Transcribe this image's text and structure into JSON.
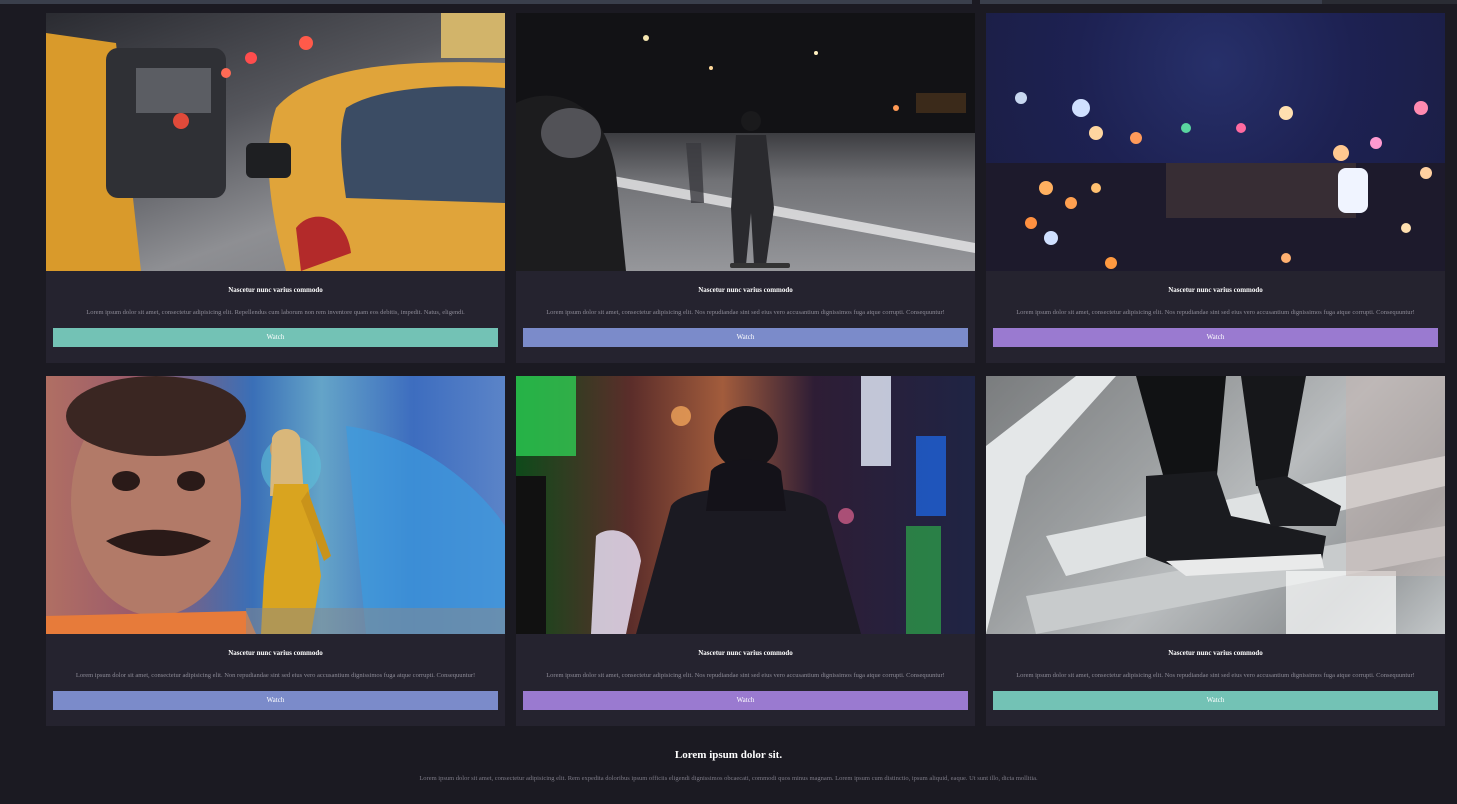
{
  "cards": [
    {
      "title": "Nascetur nunc varius commodo",
      "text": "Lorem ipsum dolor sit amet, consectetur adipisicing elit. Repellendus cum laborum non rem inventore quam eos debitis, impedit. Natus, eligendi.",
      "button": "Watch",
      "button_color": "#73c2b5",
      "image": "yellow-taxis-traffic"
    },
    {
      "title": "Nascetur nunc varius commodo",
      "text": "Lorem ipsum dolor sit amet, consectetur adipisicing elit. Nos repudiandae sint sed eius vero accusantium dignissimos fuga atque corrupti. Consequuntur!",
      "button": "Watch",
      "button_color": "#7b8bca",
      "image": "night-skateboarder"
    },
    {
      "title": "Nascetur nunc varius commodo",
      "text": "Lorem ipsum dolor sit amet, consectetur adipisicing elit. Nos repudiandae sint sed eius vero accusantium dignissimos fuga atque corrupti. Consequuntur!",
      "button": "Watch",
      "button_color": "#9a7ad0",
      "image": "city-lights-bokeh"
    },
    {
      "title": "Nascetur nunc varius commodo",
      "text": "Lorem ipsum dolor sit amet, consectetur adipisicing elit. Non repudiandae sint sed eius vero accusantium dignissimos fuga atque corrupti. Consequuntur!",
      "button": "Watch",
      "button_color": "#7b8bca",
      "image": "woman-by-mural"
    },
    {
      "title": "Nascetur nunc varius commodo",
      "text": "Lorem ipsum dolor sit amet, consectetur adipisicing elit. Nos repudiandae sint sed eius vero accusantium dignissimos fuga atque corrupti. Consequuntur!",
      "button": "Watch",
      "button_color": "#9a7ad0",
      "image": "hooded-person-neon"
    },
    {
      "title": "Nascetur nunc varius commodo",
      "text": "Lorem ipsum dolor sit amet, consectetur adipisicing elit. Nos repudiandae sint sed eius vero accusantium dignissimos fuga atque corrupti. Consequuntur!",
      "button": "Watch",
      "button_color": "#73c2b5",
      "image": "sneakers-on-stairs"
    }
  ],
  "footer": {
    "title": "Lorem ipsum dolor sit.",
    "text": "Lorem ipsum dolor sit amet, consectetur adipisicing elit. Rem expedita doloribus ipsum officiis eligendi dignissimos obcaecati, commodi quos minus magnam. Lorem ipsum cum distinctio, ipsum aliquid, eaque. Ut sunt illo, dicta mollitia."
  }
}
